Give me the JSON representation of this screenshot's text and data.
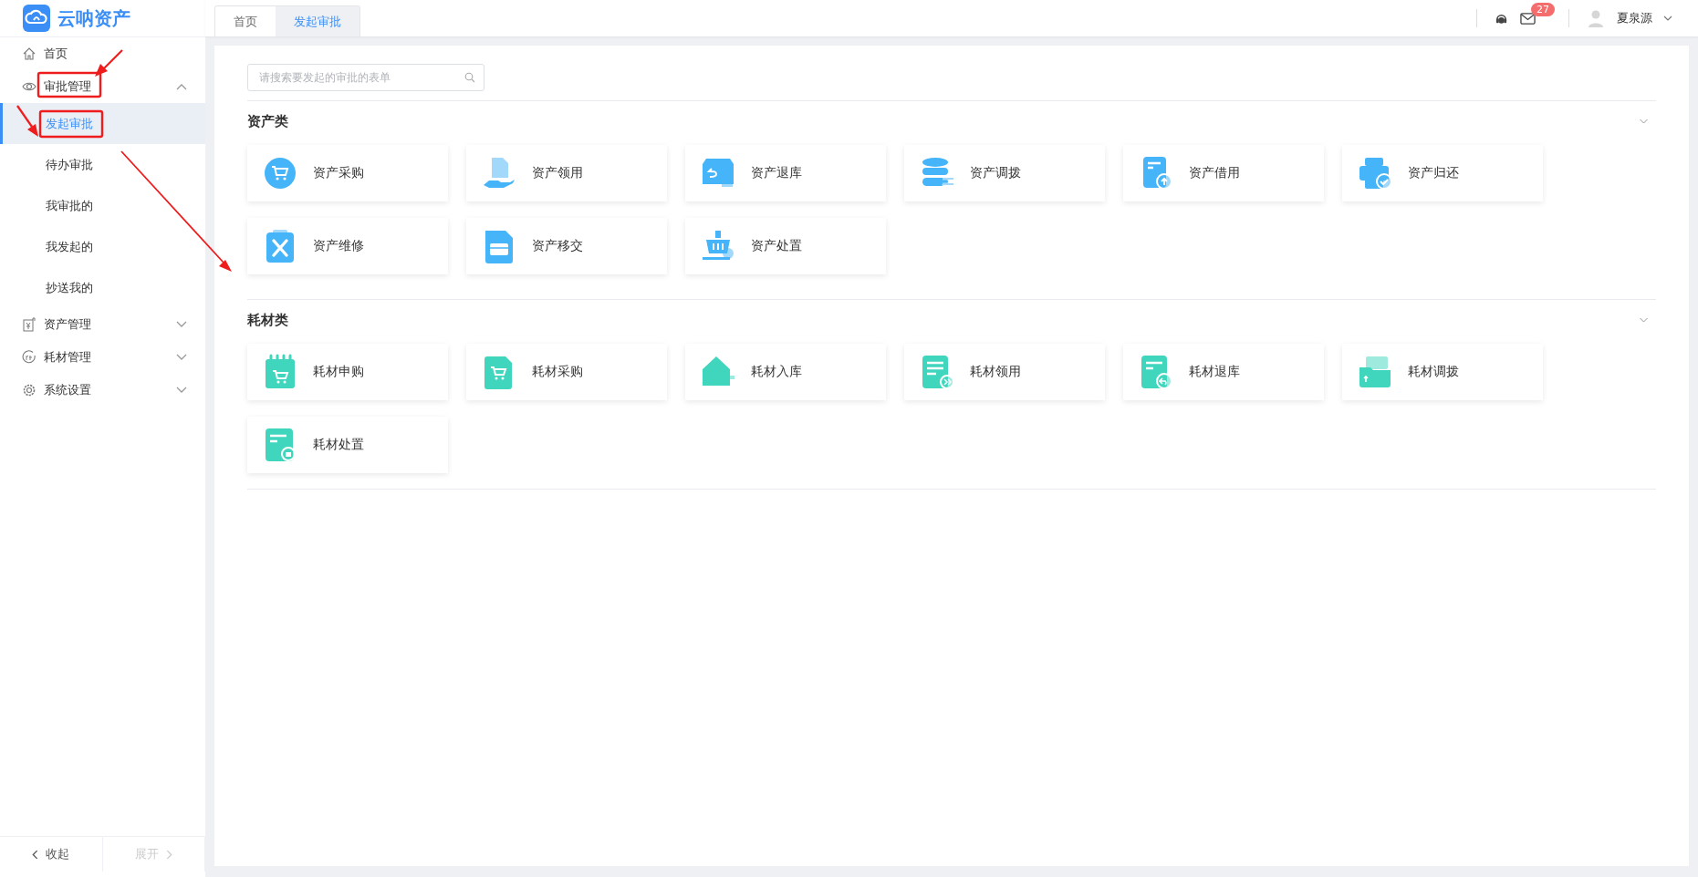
{
  "logo": {
    "text": "云呐资产"
  },
  "tabs": [
    {
      "label": "首页",
      "selected": false
    },
    {
      "label": "发起审批",
      "selected": true
    }
  ],
  "header": {
    "badge": "27",
    "user": "夏泉源"
  },
  "sidebar": {
    "items": [
      {
        "label": "首页",
        "kind": "house",
        "selected": false
      },
      {
        "label": "审批管理",
        "kind": "eye",
        "expanded": true,
        "selected": false,
        "children": [
          {
            "label": "发起审批",
            "selected": true
          },
          {
            "label": "待办审批",
            "selected": false
          },
          {
            "label": "我审批的",
            "selected": false
          },
          {
            "label": "我发起的",
            "selected": false
          },
          {
            "label": "抄送我的",
            "selected": false
          }
        ]
      },
      {
        "label": "资产管理",
        "kind": "yen",
        "expanded": false,
        "selected": false
      },
      {
        "label": "耗材管理",
        "kind": "material",
        "expanded": false,
        "selected": false
      },
      {
        "label": "系统设置",
        "kind": "gear",
        "expanded": false,
        "selected": false
      }
    ],
    "footer": [
      {
        "label": "收起",
        "disabled": false,
        "kind": "left"
      },
      {
        "label": "展开",
        "disabled": true,
        "kind": "right"
      }
    ]
  },
  "search": {
    "placeholder": "请搜索要发起的审批的表单"
  },
  "categories": [
    {
      "title": "资产类",
      "color": "#45b4f8",
      "items": [
        {
          "label": "资产采购",
          "kind": "cart-circle"
        },
        {
          "label": "资产领用",
          "kind": "hand-document"
        },
        {
          "label": "资产退库",
          "kind": "box"
        },
        {
          "label": "资产调拨",
          "kind": "database"
        },
        {
          "label": "资产借用",
          "kind": "doc-up"
        },
        {
          "label": "资产归还",
          "kind": "printer"
        },
        {
          "label": "资产维修",
          "kind": "clipboard"
        },
        {
          "label": "资产移交",
          "kind": "briefcase"
        },
        {
          "label": "资产处置",
          "kind": "basket"
        }
      ]
    },
    {
      "title": "耗材类",
      "color": "#3fd6bd",
      "items": [
        {
          "label": "耗材申购",
          "kind": "calendar-cart"
        },
        {
          "label": "耗材采购",
          "kind": "doc-cart"
        },
        {
          "label": "耗材入库",
          "kind": "house-arrow"
        },
        {
          "label": "耗材领用",
          "kind": "doc-list"
        },
        {
          "label": "耗材退库",
          "kind": "doc-return"
        },
        {
          "label": "耗材调拨",
          "kind": "folder"
        },
        {
          "label": "耗材处置",
          "kind": "doc-badge"
        }
      ]
    }
  ]
}
